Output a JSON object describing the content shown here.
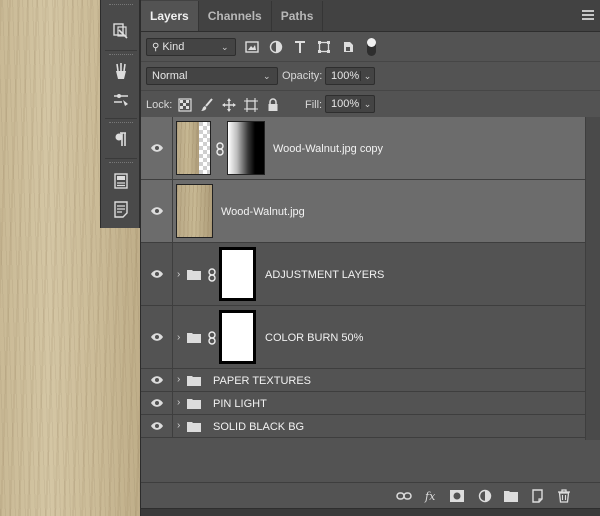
{
  "panel": {
    "tabs": [
      {
        "label": "Layers",
        "active": true
      },
      {
        "label": "Channels",
        "active": false
      },
      {
        "label": "Paths",
        "active": false
      }
    ]
  },
  "filter": {
    "kind_label": "Kind",
    "icons": [
      "image-filter-icon",
      "adjustment-filter-icon",
      "type-filter-icon",
      "shape-filter-icon",
      "smart-object-filter-icon",
      "filter-toggle-icon"
    ]
  },
  "blend": {
    "mode": "Normal",
    "opacity_label": "Opacity:",
    "opacity_value": "100%"
  },
  "lock": {
    "label": "Lock:",
    "icons": [
      "lock-transparent-pixels-icon",
      "lock-image-pixels-icon",
      "lock-position-icon",
      "lock-artboard-icon",
      "lock-all-icon"
    ],
    "fill_label": "Fill:",
    "fill_value": "100%"
  },
  "layers": [
    {
      "name": "Wood-Walnut.jpg copy",
      "type": "image-with-mask",
      "selected": true,
      "visible": true
    },
    {
      "name": "Wood-Walnut.jpg",
      "type": "image",
      "selected": true,
      "visible": true
    },
    {
      "name": "ADJUSTMENT LAYERS",
      "type": "group-with-mask",
      "selected": false,
      "visible": true
    },
    {
      "name": "COLOR BURN 50%",
      "type": "group-with-mask",
      "selected": false,
      "visible": true
    },
    {
      "name": "PAPER TEXTURES",
      "type": "group",
      "selected": false,
      "visible": true
    },
    {
      "name": "PIN LIGHT",
      "type": "group",
      "selected": false,
      "visible": true
    },
    {
      "name": "SOLID BLACK BG",
      "type": "group",
      "selected": false,
      "visible": true
    }
  ],
  "footer": {
    "icons": [
      "link-layers-icon",
      "layer-style-fx-icon",
      "add-mask-icon",
      "new-adjustment-layer-icon",
      "new-group-icon",
      "new-layer-icon",
      "delete-layer-icon"
    ]
  },
  "colors": {
    "panel_bg": "#535353",
    "selected_row": "#6c6c6c",
    "text": "#f2f2f2"
  }
}
